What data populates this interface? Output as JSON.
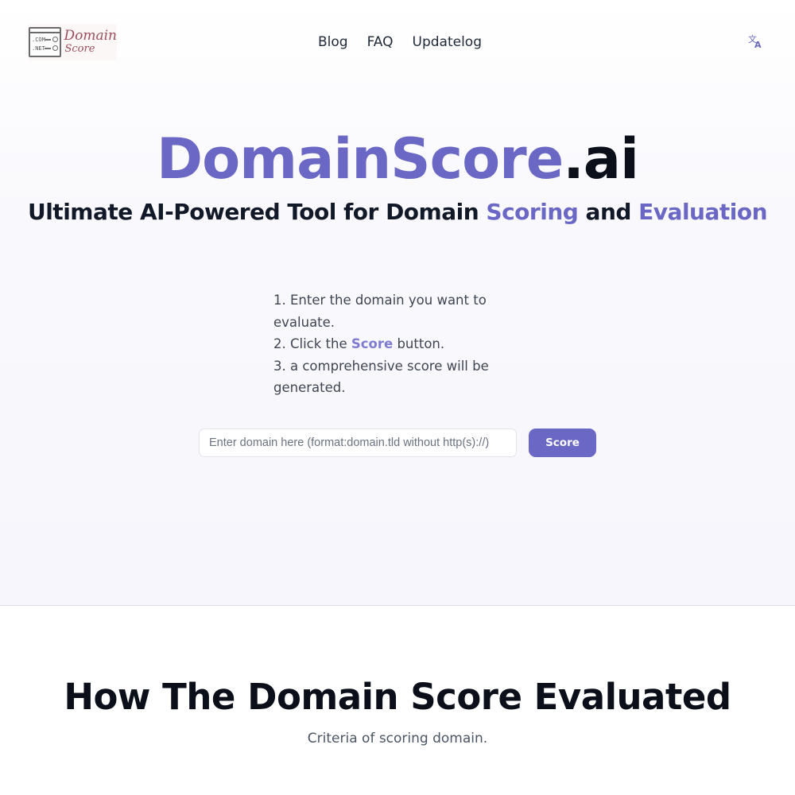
{
  "header": {
    "logo": {
      "line1": "Domain",
      "line2": "Score",
      "badge_top": ".COM",
      "badge_bottom": ".NET"
    },
    "nav": [
      {
        "label": "Blog"
      },
      {
        "label": "FAQ"
      },
      {
        "label": "Updatelog"
      }
    ],
    "language_icon": "translate-icon"
  },
  "hero": {
    "brand_main": "DomainScore",
    "brand_suffix": ".ai",
    "tagline_pre": "Ultimate AI-Powered Tool for Domain ",
    "tagline_hl1": "Scoring",
    "tagline_mid": " and ",
    "tagline_hl2": "Evaluation",
    "steps": {
      "step1": "1. Enter the domain you want to evaluate.",
      "step2_pre": "2. Click the ",
      "step2_kw": "Score",
      "step2_post": " button.",
      "step3": "3. a comprehensive score will be generated."
    },
    "search": {
      "value": "",
      "placeholder": "Enter domain here (format:domain.tld without http(s)://)",
      "button_label": "Score"
    }
  },
  "section": {
    "title": "How The Domain Score Evaluated",
    "subtitle": "Criteria of scoring domain."
  },
  "colors": {
    "accent": "#6a67c5",
    "logo_text": "#9b4d5e"
  }
}
